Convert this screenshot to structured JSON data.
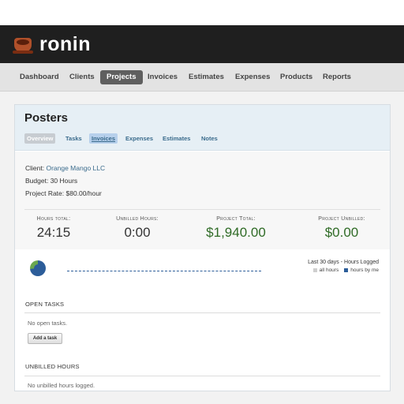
{
  "brand": {
    "name": "ronin"
  },
  "nav": {
    "items": [
      {
        "label": "Dashboard"
      },
      {
        "label": "Clients"
      },
      {
        "label": "Projects"
      },
      {
        "label": "Invoices"
      },
      {
        "label": "Estimates"
      },
      {
        "label": "Expenses"
      },
      {
        "label": "Products"
      },
      {
        "label": "Reports"
      }
    ],
    "active": "Projects"
  },
  "project": {
    "title": "Posters",
    "tabs": [
      {
        "label": "Overview"
      },
      {
        "label": "Tasks"
      },
      {
        "label": "Invoices"
      },
      {
        "label": "Expenses"
      },
      {
        "label": "Estimates"
      },
      {
        "label": "Notes"
      }
    ],
    "active_tab": "Overview",
    "info": {
      "client_label": "Client:",
      "client_value": "Orange Mango LLC",
      "budget_label": "Budget:",
      "budget_value": "30 Hours",
      "rate_label": "Project Rate:",
      "rate_value": "$80.00/hour"
    },
    "stats": [
      {
        "label": "Hours total:",
        "value": "24:15"
      },
      {
        "label": "Unbilled Hours:",
        "value": "0:00"
      },
      {
        "label": "Project Total:",
        "value": "$1,940.00"
      },
      {
        "label": "Project Unbilled:",
        "value": "$0.00"
      }
    ]
  },
  "chart": {
    "title": "Last 30 days - Hours Logged",
    "legend_all": "all hours",
    "legend_me": "hours by me",
    "colors": {
      "all": "#cfcfcf",
      "me": "#2c5d99",
      "pie_other": "#6aa84f"
    }
  },
  "tasks": {
    "heading": "OPEN TASKS",
    "empty": "No open tasks.",
    "add_label": "Add a task"
  },
  "unbilled": {
    "heading": "UNBILLED HOURS",
    "empty": "No unbilled hours logged."
  }
}
